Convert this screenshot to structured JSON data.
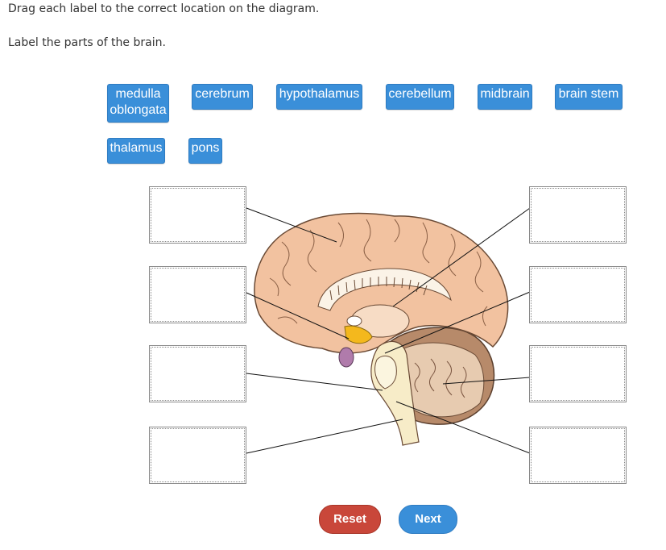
{
  "instructions": {
    "line1": "Drag each label to the correct location on the diagram.",
    "line2": "Label the parts of the brain."
  },
  "labels": [
    {
      "text": "medulla\noblongata"
    },
    {
      "text": "cerebrum"
    },
    {
      "text": "hypothalamus"
    },
    {
      "text": "cerebellum"
    },
    {
      "text": "midbrain"
    },
    {
      "text": "brain stem"
    },
    {
      "text": "thalamus"
    },
    {
      "text": "pons"
    }
  ],
  "buttons": {
    "reset": "Reset",
    "next": "Next"
  },
  "colors": {
    "label_bg": "#3a8fd9",
    "reset_bg": "#c9473a",
    "next_bg": "#3a8fd9",
    "cerebrum": "#f2c2a0",
    "cerebellum": "#b78a6a",
    "brainstem": "#f7ecc8",
    "hypothalamus": "#f4b81d",
    "pituitary": "#b07bab"
  }
}
